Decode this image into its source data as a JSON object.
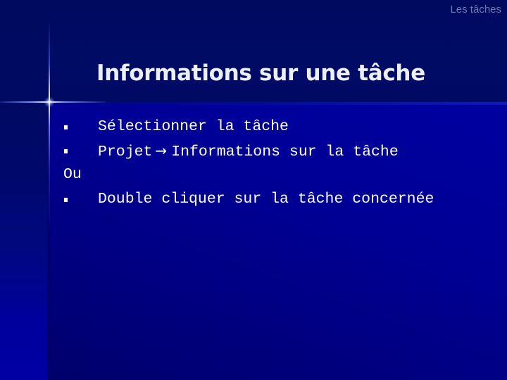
{
  "header": {
    "section_label": "Les tâches"
  },
  "slide": {
    "title": "Informations sur une tâche",
    "items": [
      {
        "type": "bullet",
        "text": "Sélectionner la tâche"
      },
      {
        "type": "bullet",
        "text_before": "Projet",
        "arrow_icon": "right-arrow-icon",
        "text_after": "Informations sur la tâche"
      },
      {
        "type": "plain",
        "text": "Ou"
      },
      {
        "type": "bullet",
        "text": "Double cliquer sur la tâche concernée"
      }
    ]
  },
  "colors": {
    "background_dark": "#000a62",
    "background_body": "#000096",
    "title_text": "#eceef8",
    "header_text": "#6d78b4",
    "body_text": "#ffffff"
  }
}
